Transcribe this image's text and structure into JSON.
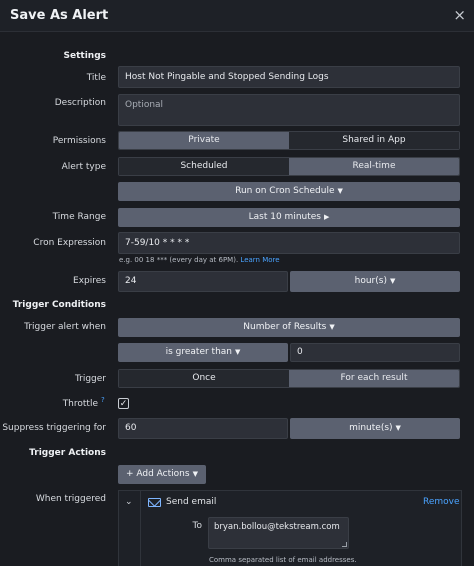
{
  "header": {
    "title": "Save As Alert",
    "close": "×"
  },
  "sections": {
    "settings": "Settings",
    "trigger_conditions": "Trigger Conditions",
    "trigger_actions": "Trigger Actions"
  },
  "labels": {
    "title": "Title",
    "description": "Description",
    "permissions": "Permissions",
    "alert_type": "Alert type",
    "time_range": "Time Range",
    "cron_expression": "Cron Expression",
    "expires": "Expires",
    "trigger_alert_when": "Trigger alert when",
    "trigger": "Trigger",
    "throttle": "Throttle",
    "throttle_help": "?",
    "suppress_for": "Suppress triggering for",
    "when_triggered": "When triggered"
  },
  "fields": {
    "title_value": "Host Not Pingable and Stopped Sending Logs",
    "description_placeholder": "Optional",
    "cron_value": "7-59/10 * * * *",
    "cron_help": "e.g. 00 18 *** (every day at 6PM).",
    "cron_help_link": "Learn More",
    "expires_value": "24",
    "expires_unit": "hour(s)",
    "threshold_value": "0",
    "suppress_value": "60",
    "suppress_unit": "minute(s)"
  },
  "permissions": {
    "private": "Private",
    "shared": "Shared in App",
    "selected": "Private"
  },
  "alert_type": {
    "scheduled": "Scheduled",
    "realtime": "Real-time",
    "selected": "Real-time"
  },
  "schedule_dropdown": "Run on Cron Schedule",
  "time_range_dropdown": "Last 10 minutes",
  "trigger_when_dropdown": "Number of Results",
  "comparison_dropdown": "is greater than",
  "trigger": {
    "once": "Once",
    "each": "For each result",
    "selected": "For each result"
  },
  "throttle_checked": true,
  "actions": {
    "add_button": "+ Add Actions",
    "send_email": "Send email",
    "remove": "Remove",
    "to_label": "To",
    "to_value": "bryan.bollou@tekstream.com",
    "to_help": "Comma separated list of email addresses."
  },
  "colors": {
    "accent": "#4aa3ff",
    "selected_segment": "#5b6170",
    "background": "#1a1c21"
  }
}
